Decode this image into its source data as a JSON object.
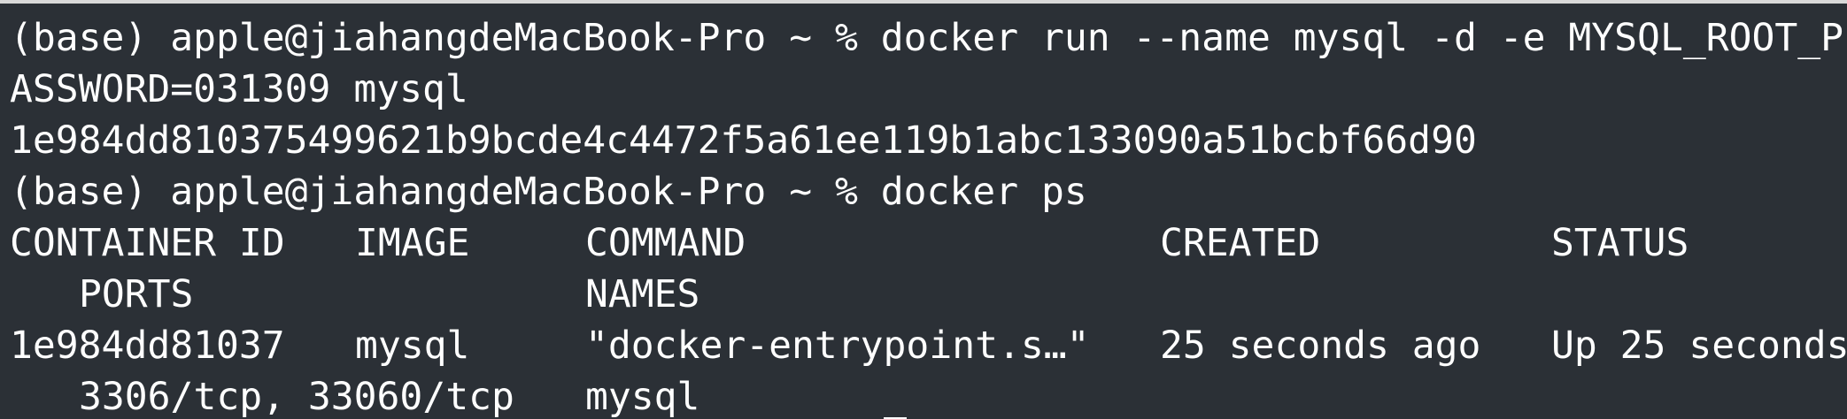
{
  "terminal": {
    "line1": "(base) apple@jiahangdeMacBook-Pro ~ % docker run --name mysql -d -e MYSQL_ROOT_P",
    "line2": "ASSWORD=031309 mysql",
    "line3": "1e984dd810375499621b9bcde4c4472f5a61ee119b1abc133090a51bcbf66d90",
    "line4": "(base) apple@jiahangdeMacBook-Pro ~ % docker ps",
    "headers": {
      "container_id": "CONTAINER ID",
      "image": "IMAGE",
      "command": "COMMAND",
      "created": "CREATED",
      "status": "STATUS",
      "ports": "PORTS",
      "names": "NAMES"
    },
    "row": {
      "container_id": "1e984dd81037",
      "image": "mysql",
      "command": "\"docker-entrypoint.s…\"",
      "created": "25 seconds ago",
      "status": "Up 25 seconds",
      "ports": "3306/tcp, 33060/tcp",
      "names": "mysql"
    }
  }
}
